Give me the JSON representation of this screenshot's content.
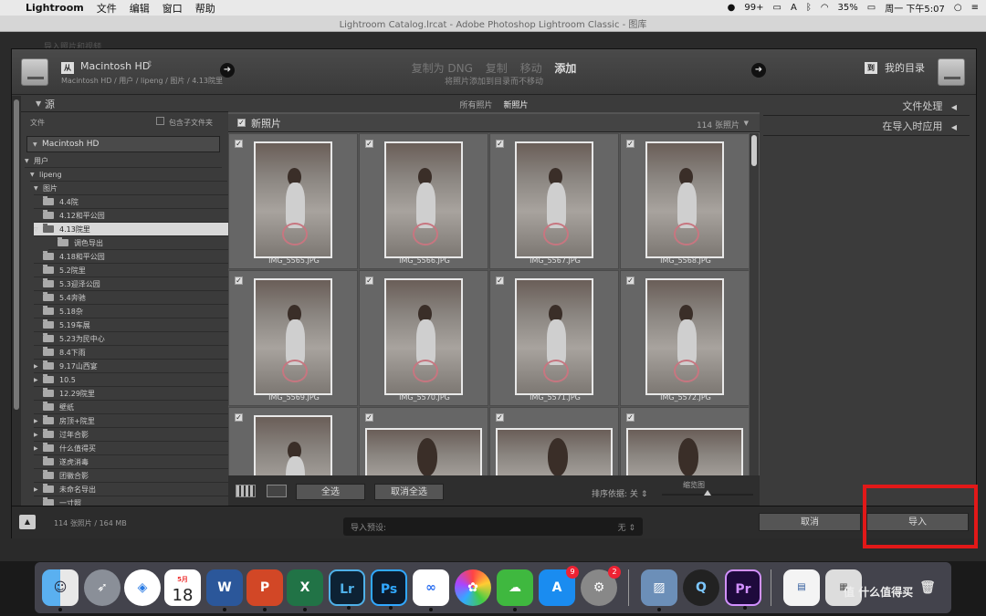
{
  "menubar": {
    "app_name": "Lightroom",
    "menus": [
      "文件",
      "编辑",
      "窗口",
      "帮助"
    ],
    "notification_count": "99+",
    "battery": "35%",
    "clock": "周一 下午5:07"
  },
  "window": {
    "title": "Lightroom Catalog.lrcat - Adobe Photoshop Lightroom Classic - 图库",
    "behind_text": "导入照片和视频"
  },
  "topbar": {
    "source_tag": "从",
    "source_name": "Macintosh HD",
    "source_path": "Macintosh HD / 用户 / lipeng / 图片 / 4.13院里",
    "modes": [
      "复制为 DNG",
      "复制",
      "移动",
      "添加"
    ],
    "active_mode": "添加",
    "mode_description": "将照片添加到目录而不移动",
    "dest_tag": "到",
    "dest_name": "我的目录"
  },
  "source_panel": {
    "title": "源",
    "files_label": "文件",
    "include_subfolders": "包含子文件夹",
    "volume": "Macintosh HD",
    "tree": {
      "users": "用户",
      "user": "lipeng",
      "pictures": "图片"
    },
    "folders": [
      {
        "label": "4.4院",
        "expand": false
      },
      {
        "label": "4.12和平公园",
        "expand": false
      },
      {
        "label": "4.13院里",
        "expand": true,
        "selected": true
      },
      {
        "label": "调色导出",
        "child": true
      },
      {
        "label": "4.18和平公园",
        "expand": false
      },
      {
        "label": "5.2院里",
        "expand": false
      },
      {
        "label": "5.3迎泽公园",
        "expand": false
      },
      {
        "label": "5.4奔驰",
        "expand": false
      },
      {
        "label": "5.18杂",
        "expand": false
      },
      {
        "label": "5.19车展",
        "expand": false
      },
      {
        "label": "5.23为民中心",
        "expand": false
      },
      {
        "label": "8.4下雨",
        "expand": false
      },
      {
        "label": "9.17山西宴",
        "expand": true
      },
      {
        "label": "10.5",
        "expand": true
      },
      {
        "label": "12.29院里",
        "expand": false
      },
      {
        "label": "壁纸",
        "expand": false
      },
      {
        "label": "房顶+院里",
        "expand": true
      },
      {
        "label": "过年合影",
        "expand": true
      },
      {
        "label": "什么值得买",
        "expand": true
      },
      {
        "label": "遂虎消毒",
        "expand": false
      },
      {
        "label": "团徽合影",
        "expand": false
      },
      {
        "label": "未命名导出",
        "expand": true
      },
      {
        "label": "一寸照",
        "expand": false
      }
    ]
  },
  "filters": [
    "所有照片",
    "新照片"
  ],
  "active_filter": "新照片",
  "grid": {
    "title": "新照片",
    "count": "114 张照片",
    "photos": [
      {
        "file": "IMG_5565.JPG",
        "orientation": "portrait"
      },
      {
        "file": "IMG_5566.JPG",
        "orientation": "portrait"
      },
      {
        "file": "IMG_5567.JPG",
        "orientation": "portrait"
      },
      {
        "file": "IMG_5568.JPG",
        "orientation": "portrait"
      },
      {
        "file": "IMG_5569.JPG",
        "orientation": "portrait"
      },
      {
        "file": "IMG_5570.JPG",
        "orientation": "portrait"
      },
      {
        "file": "IMG_5571.JPG",
        "orientation": "portrait"
      },
      {
        "file": "IMG_5572.JPG",
        "orientation": "portrait"
      },
      {
        "file": "",
        "orientation": "portrait"
      },
      {
        "file": "",
        "orientation": "landscape"
      },
      {
        "file": "",
        "orientation": "landscape"
      },
      {
        "file": "",
        "orientation": "landscape"
      }
    ]
  },
  "toolbar": {
    "select_all": "全选",
    "deselect_all": "取消全选",
    "sort_label": "排序依据:",
    "sort_value": "关",
    "zoom_label": "缩览图"
  },
  "right_panel": {
    "file_handling": "文件处理",
    "apply_during_import": "在导入时应用"
  },
  "bottombar": {
    "stats": "114 张照片 / 164 MB",
    "preset_label": "导入预设:",
    "preset_value": "无",
    "cancel": "取消",
    "import": "导入"
  },
  "dock": {
    "calendar_month": "5月",
    "calendar_day": "18",
    "appstore_badge": "9",
    "settings_badge": "2",
    "watermark": "值 什么值得买"
  },
  "colors": {
    "highlight": "#e21818",
    "panel_bg": "#3b3b3b",
    "grid_bg": "#555555"
  }
}
